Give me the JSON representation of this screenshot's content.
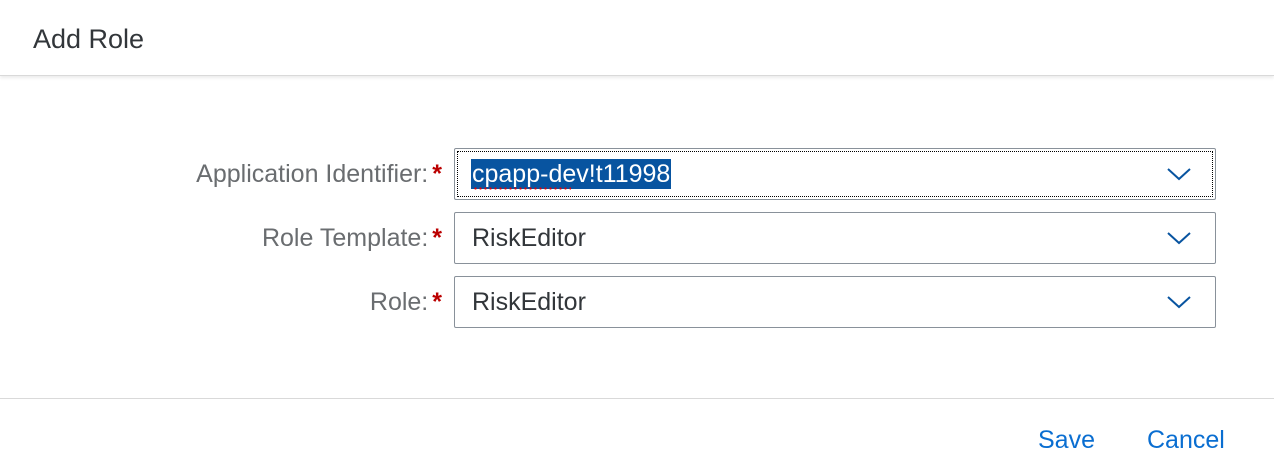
{
  "dialog": {
    "title": "Add Role"
  },
  "form": {
    "required_marker": "*",
    "fields": [
      {
        "label": "Application Identifier:",
        "value": "cpapp-dev!t11998"
      },
      {
        "label": "Role Template:",
        "value": "RiskEditor"
      },
      {
        "label": "Role:",
        "value": "RiskEditor"
      }
    ]
  },
  "footer": {
    "save_label": "Save",
    "cancel_label": "Cancel"
  },
  "colors": {
    "accent": "#0a6ed1",
    "selection": "#0854a0",
    "required": "#bb0000",
    "label": "#6a6d70",
    "text": "#32363a"
  },
  "icons": {
    "dropdown": "chevron-down-icon"
  }
}
